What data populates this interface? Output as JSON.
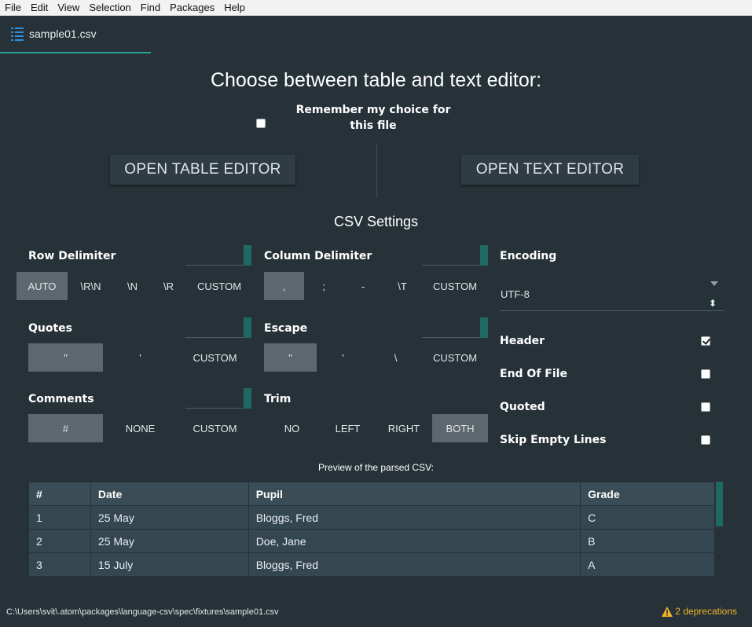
{
  "menu": [
    "File",
    "Edit",
    "View",
    "Selection",
    "Find",
    "Packages",
    "Help"
  ],
  "tab": {
    "title": "sample01.csv"
  },
  "chooser": {
    "heading": "Choose between table and text editor:",
    "remember_label": "Remember my choice for this file",
    "open_table": "OPEN TABLE EDITOR",
    "open_text": "OPEN TEXT EDITOR"
  },
  "settings": {
    "heading": "CSV Settings",
    "row_delimiter": {
      "label": "Row Delimiter",
      "options": [
        "AUTO",
        "\\R\\N",
        "\\N",
        "\\R",
        "CUSTOM"
      ],
      "selected": "AUTO"
    },
    "column_delimiter": {
      "label": "Column Delimiter",
      "options": [
        ",",
        ";",
        "-",
        "\\T",
        "CUSTOM"
      ],
      "selected": ","
    },
    "quotes": {
      "label": "Quotes",
      "options": [
        "\"",
        "'",
        "CUSTOM"
      ],
      "selected": "\""
    },
    "escape": {
      "label": "Escape",
      "options": [
        "\"",
        "'",
        "\\",
        "CUSTOM"
      ],
      "selected": "\""
    },
    "comments": {
      "label": "Comments",
      "options": [
        "#",
        "NONE",
        "CUSTOM"
      ],
      "selected": "#"
    },
    "trim": {
      "label": "Trim",
      "options": [
        "NO",
        "LEFT",
        "RIGHT",
        "BOTH"
      ],
      "selected": "BOTH"
    },
    "encoding": {
      "label": "Encoding",
      "value": "UTF-8"
    },
    "checks": [
      {
        "label": "Header",
        "checked": true
      },
      {
        "label": "End Of File",
        "checked": false
      },
      {
        "label": "Quoted",
        "checked": false
      },
      {
        "label": "Skip Empty Lines",
        "checked": false
      }
    ]
  },
  "preview": {
    "label": "Preview of the parsed CSV:",
    "columns": [
      "#",
      "Date",
      "Pupil",
      "Grade"
    ],
    "rows": [
      [
        "1",
        "25 May",
        "Bloggs, Fred",
        "C"
      ],
      [
        "2",
        "25 May",
        "Doe, Jane",
        "B"
      ],
      [
        "3",
        "15 July",
        "Bloggs, Fred",
        "A"
      ]
    ]
  },
  "status": {
    "path": "C:\\Users\\svit\\.atom\\packages\\language-csv\\spec\\fixtures\\sample01.csv",
    "deprecations": "2 deprecations"
  },
  "colors": {
    "accent": "#2aa198",
    "selected_option": "#5d676d",
    "warning": "#f0b429"
  }
}
